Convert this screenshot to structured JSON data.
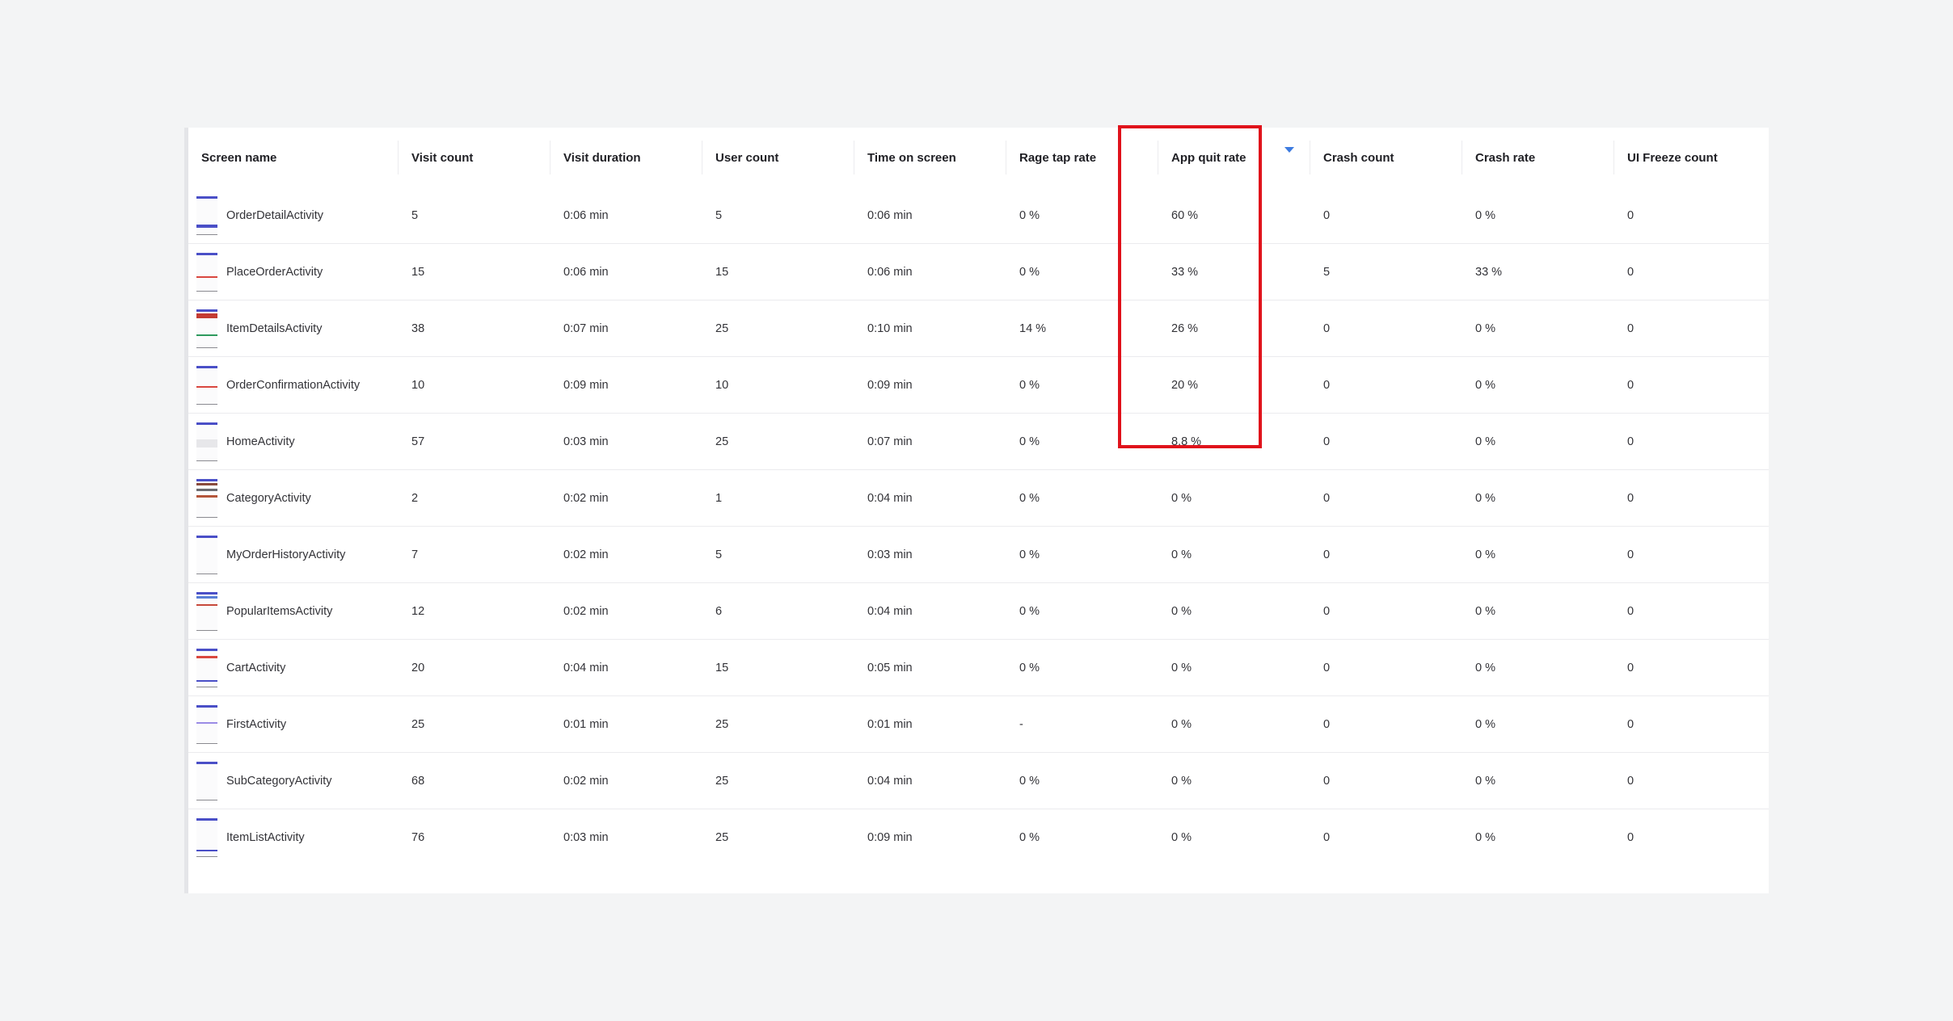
{
  "table": {
    "columns": [
      "Screen name",
      "Visit count",
      "Visit duration",
      "User count",
      "Time on screen",
      "Rage tap rate",
      "App quit rate",
      "Crash count",
      "Crash rate",
      "UI Freeze count"
    ],
    "sorted_column": "App quit rate",
    "sort_direction": "descending",
    "rows": [
      {
        "screen_name": "OrderDetailActivity",
        "visit_count": "5",
        "visit_duration": "0:06 min",
        "user_count": "5",
        "time_on_screen": "0:06 min",
        "rage_tap_rate": "0 %",
        "app_quit_rate": "60 %",
        "crash_count": "0",
        "crash_rate": "0 %",
        "ui_freeze_count": "0"
      },
      {
        "screen_name": "PlaceOrderActivity",
        "visit_count": "15",
        "visit_duration": "0:06 min",
        "user_count": "15",
        "time_on_screen": "0:06 min",
        "rage_tap_rate": "0 %",
        "app_quit_rate": "33 %",
        "crash_count": "5",
        "crash_rate": "33 %",
        "ui_freeze_count": "0"
      },
      {
        "screen_name": "ItemDetailsActivity",
        "visit_count": "38",
        "visit_duration": "0:07 min",
        "user_count": "25",
        "time_on_screen": "0:10 min",
        "rage_tap_rate": "14 %",
        "app_quit_rate": "26 %",
        "crash_count": "0",
        "crash_rate": "0 %",
        "ui_freeze_count": "0"
      },
      {
        "screen_name": "OrderConfirmationActivity",
        "visit_count": "10",
        "visit_duration": "0:09 min",
        "user_count": "10",
        "time_on_screen": "0:09 min",
        "rage_tap_rate": "0 %",
        "app_quit_rate": "20 %",
        "crash_count": "0",
        "crash_rate": "0 %",
        "ui_freeze_count": "0"
      },
      {
        "screen_name": "HomeActivity",
        "visit_count": "57",
        "visit_duration": "0:03 min",
        "user_count": "25",
        "time_on_screen": "0:07 min",
        "rage_tap_rate": "0 %",
        "app_quit_rate": "8.8 %",
        "crash_count": "0",
        "crash_rate": "0 %",
        "ui_freeze_count": "0"
      },
      {
        "screen_name": "CategoryActivity",
        "visit_count": "2",
        "visit_duration": "0:02 min",
        "user_count": "1",
        "time_on_screen": "0:04 min",
        "rage_tap_rate": "0 %",
        "app_quit_rate": "0 %",
        "crash_count": "0",
        "crash_rate": "0 %",
        "ui_freeze_count": "0"
      },
      {
        "screen_name": "MyOrderHistoryActivity",
        "visit_count": "7",
        "visit_duration": "0:02 min",
        "user_count": "5",
        "time_on_screen": "0:03 min",
        "rage_tap_rate": "0 %",
        "app_quit_rate": "0 %",
        "crash_count": "0",
        "crash_rate": "0 %",
        "ui_freeze_count": "0"
      },
      {
        "screen_name": "PopularItemsActivity",
        "visit_count": "12",
        "visit_duration": "0:02 min",
        "user_count": "6",
        "time_on_screen": "0:04 min",
        "rage_tap_rate": "0 %",
        "app_quit_rate": "0 %",
        "crash_count": "0",
        "crash_rate": "0 %",
        "ui_freeze_count": "0"
      },
      {
        "screen_name": "CartActivity",
        "visit_count": "20",
        "visit_duration": "0:04 min",
        "user_count": "15",
        "time_on_screen": "0:05 min",
        "rage_tap_rate": "0 %",
        "app_quit_rate": "0 %",
        "crash_count": "0",
        "crash_rate": "0 %",
        "ui_freeze_count": "0"
      },
      {
        "screen_name": "FirstActivity",
        "visit_count": "25",
        "visit_duration": "0:01 min",
        "user_count": "25",
        "time_on_screen": "0:01 min",
        "rage_tap_rate": "-",
        "app_quit_rate": "0 %",
        "crash_count": "0",
        "crash_rate": "0 %",
        "ui_freeze_count": "0"
      },
      {
        "screen_name": "SubCategoryActivity",
        "visit_count": "68",
        "visit_duration": "0:02 min",
        "user_count": "25",
        "time_on_screen": "0:04 min",
        "rage_tap_rate": "0 %",
        "app_quit_rate": "0 %",
        "crash_count": "0",
        "crash_rate": "0 %",
        "ui_freeze_count": "0"
      },
      {
        "screen_name": "ItemListActivity",
        "visit_count": "76",
        "visit_duration": "0:03 min",
        "user_count": "25",
        "time_on_screen": "0:09 min",
        "rage_tap_rate": "0 %",
        "app_quit_rate": "0 %",
        "crash_count": "0",
        "crash_rate": "0 %",
        "ui_freeze_count": "0"
      }
    ]
  },
  "colors": {
    "background": "#f3f4f5",
    "panel": "#ffffff",
    "highlight_box": "#e0121b",
    "sort_arrow": "#3d7be0",
    "thumbnail_accent": "#4a4fc7"
  },
  "icons": {
    "sort_indicator": "caret-down-icon",
    "screen_thumbnail": "screen-thumbnail-icon"
  }
}
